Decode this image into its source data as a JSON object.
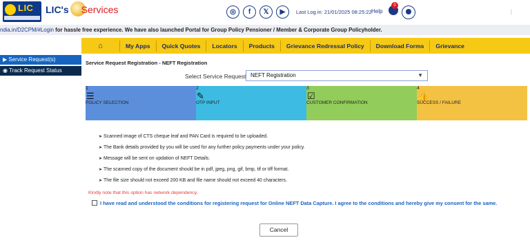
{
  "header": {
    "logo_text": "LIC",
    "brand_prefix": "LIC's",
    "brand_services": "Services",
    "social": [
      {
        "name": "instagram-icon",
        "glyph": "◎"
      },
      {
        "name": "facebook-icon",
        "glyph": "f"
      },
      {
        "name": "twitter-x-icon",
        "glyph": "𝕏"
      },
      {
        "name": "youtube-icon",
        "glyph": "▶"
      }
    ],
    "last_login": "Last Log in: 21/01/2025 08:25:22",
    "help": "Help",
    "notification_count": "0",
    "more": "⋮"
  },
  "ticker": {
    "link": "ndia.in/D2CPM/#Login",
    "text": " for hassle free experience.  We have also launched Portal for Group Policy Pensioner / Member & Corporate Group Policyholder."
  },
  "nav": {
    "home_icon": "⌂",
    "items": [
      "My Apps",
      "Quick Quotes",
      "Locators",
      "Products",
      "Grievance Redressal Policy",
      "Download Forms",
      "Grievance"
    ]
  },
  "sidebar": {
    "items": [
      {
        "label": "Service Request(s)",
        "icon": "▶"
      },
      {
        "label": "Track Request Status",
        "icon": "◉"
      }
    ]
  },
  "main": {
    "title": "Service Request Registration - NEFT Registration",
    "select_label": "Select Service Request",
    "select_value": "NEFT Registration",
    "steps": [
      {
        "num": "1",
        "label": "POLICY SELECTION",
        "icon": "☰",
        "color": "#5b8fdc"
      },
      {
        "num": "2",
        "label": "OTP INPUT",
        "icon": "✎",
        "color": "#3dbbe2"
      },
      {
        "num": "3",
        "label": "CUSTOMER CONFIRMATION",
        "icon": "☑",
        "color": "#92cc5a"
      },
      {
        "num": "4",
        "label": "SUCCESS / FAILURE",
        "icon": "👍",
        "color": "#f4c242"
      }
    ],
    "bullets": [
      "Scanned image of CTS cheque leaf and PAN Card is required to be uploaded.",
      "The Bank details provided by you will be used for any further policy payments under your policy.",
      "Message will be sent on updation of NEFT Details.",
      "The scanned copy of the document should be in pdf, jpeg, png, gif, bmp, tif or tiff format.",
      "The file size should not exceed 200 KB and file name should not exceed 40 characters."
    ],
    "note": "Kindly note that this option has network dependency.",
    "consent": "I have read and understood the conditions for registering request for Online NEFT Data Capture. I agree to the conditions and hereby give my consent for the same.",
    "cancel": "Cancel"
  },
  "colors": {
    "navbar": "#f6c915",
    "sidebar_active": "#1565c0",
    "sidebar_dark": "#0b2a4e",
    "brand_blue": "#1b3a86"
  }
}
